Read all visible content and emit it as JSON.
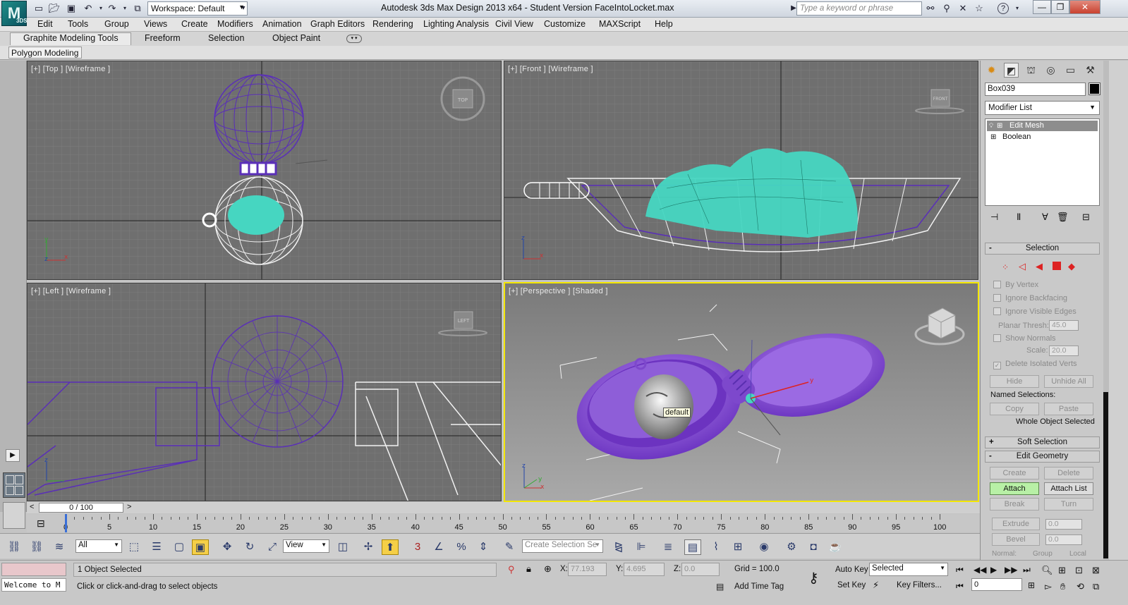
{
  "app": {
    "title": "Autodesk 3ds Max Design 2013 x64 - Student Version    FaceIntoLocket.max",
    "logo_text": "3DS",
    "workspace": "Workspace: Default",
    "search_placeholder": "Type a keyword or phrase"
  },
  "menus": [
    "Edit",
    "Tools",
    "Group",
    "Views",
    "Create",
    "Modifiers",
    "Animation",
    "Graph Editors",
    "Rendering",
    "Lighting Analysis",
    "Civil View",
    "Customize",
    "MAXScript",
    "Help"
  ],
  "ribbon": {
    "tabs": [
      "Graphite Modeling Tools",
      "Freeform",
      "Selection",
      "Object Paint"
    ],
    "panel": "Polygon Modeling"
  },
  "viewports": {
    "top": {
      "label": "[+] [Top ] [Wireframe ]",
      "cube": "TOP"
    },
    "front": {
      "label": "[+] [Front ] [Wireframe ]",
      "cube": "FRONT"
    },
    "left": {
      "label": "[+] [Left ] [Wireframe ]",
      "cube": "LEFT"
    },
    "persp": {
      "label": "[+] [Perspective ] [Shaded ]",
      "tooltip": "default"
    }
  },
  "command_panel": {
    "object_name": "Box039",
    "modifier_list": "Modifier List",
    "stack": [
      "Edit Mesh",
      "Boolean"
    ],
    "selection": {
      "title": "Selection",
      "by_vertex": "By Vertex",
      "ignore_backfacing": "Ignore Backfacing",
      "ignore_visible_edges": "Ignore Visible Edges",
      "planar_thresh": "Planar Thresh:",
      "planar_val": "45.0",
      "show_normals": "Show Normals",
      "scale": "Scale:",
      "scale_val": "20.0",
      "delete_isolated": "Delete Isolated Verts",
      "hide": "Hide",
      "unhide_all": "Unhide All",
      "named_selections": "Named Selections:",
      "copy": "Copy",
      "paste": "Paste",
      "status": "Whole Object Selected"
    },
    "soft_selection": "Soft Selection",
    "edit_geometry": {
      "title": "Edit Geometry",
      "create": "Create",
      "delete": "Delete",
      "attach": "Attach",
      "attach_list": "Attach List",
      "break": "Break",
      "turn": "Turn",
      "extrude": "Extrude",
      "extrude_val": "0.0",
      "bevel": "Bevel",
      "bevel_val": "0.0",
      "normal": "Normal:",
      "group": "Group",
      "local": "Local"
    }
  },
  "timeline": {
    "frame": "0 / 100",
    "ticks": [
      0,
      5,
      10,
      15,
      20,
      25,
      30,
      35,
      40,
      45,
      50,
      55,
      60,
      65,
      70,
      75,
      80,
      85,
      90,
      95,
      100
    ]
  },
  "toolbar": {
    "filter": "All",
    "ref_coord": "View",
    "selection_set_placeholder": "Create Selection Se"
  },
  "status": {
    "maxscript": "Welcome to M",
    "selected": "1 Object Selected",
    "prompt": "Click or click-and-drag to select objects",
    "x_label": "X:",
    "x": "77.193",
    "y_label": "Y:",
    "y": "4.695",
    "z_label": "Z:",
    "z": "0.0",
    "grid": "Grid = 100.0",
    "add_time_tag": "Add Time Tag",
    "auto_key": "Auto Key",
    "set_key": "Set Key",
    "selected_dd": "Selected",
    "key_filters": "Key Filters...",
    "current_frame": "0"
  }
}
